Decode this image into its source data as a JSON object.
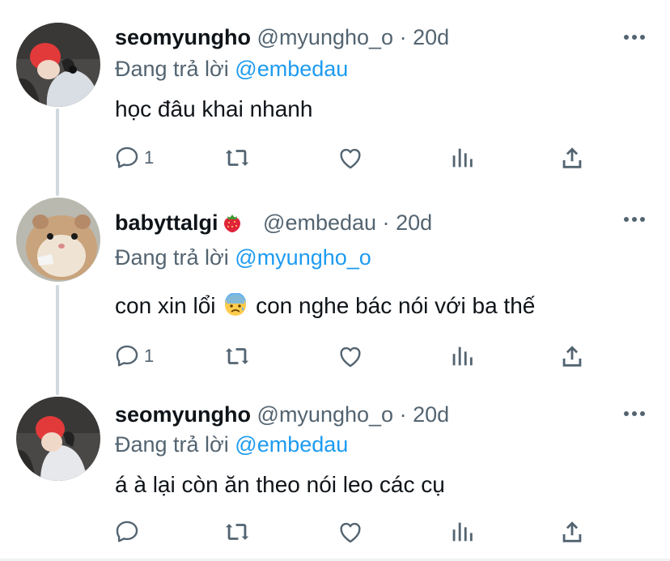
{
  "tweets": [
    {
      "name": "seomyungho",
      "handle": "@myungho_o",
      "separator": "·",
      "time": "20d",
      "reply_prefix": "Đang trả lời",
      "reply_to": "@embedau",
      "text": "học đâu khai nhanh",
      "reply_count": "1",
      "avatar": "profile-photo-red-hair"
    },
    {
      "name": "babyttalgi",
      "name_emoji": "strawberry-icon",
      "handle": "@embedau",
      "separator": "·",
      "time": "20d",
      "reply_prefix": "Đang trả lời",
      "reply_to": "@myungho_o",
      "text_before": "con xin lổi",
      "text_emoji": "anxious-face-icon",
      "text_after": " con nghe bác nói với ba thế",
      "reply_count": "1",
      "avatar": "profile-photo-hamster"
    },
    {
      "name": "seomyungho",
      "handle": "@myungho_o",
      "separator": "·",
      "time": "20d",
      "reply_prefix": "Đang trả lời",
      "reply_to": "@embedau",
      "text": "á à lại còn ăn theo nói leo các cụ",
      "reply_count": "",
      "avatar": "profile-photo-red-hair"
    }
  ],
  "colors": {
    "text": "#0f1419",
    "secondary": "#536471",
    "link": "#1d9bf0",
    "thread_line": "#cfd9de"
  }
}
